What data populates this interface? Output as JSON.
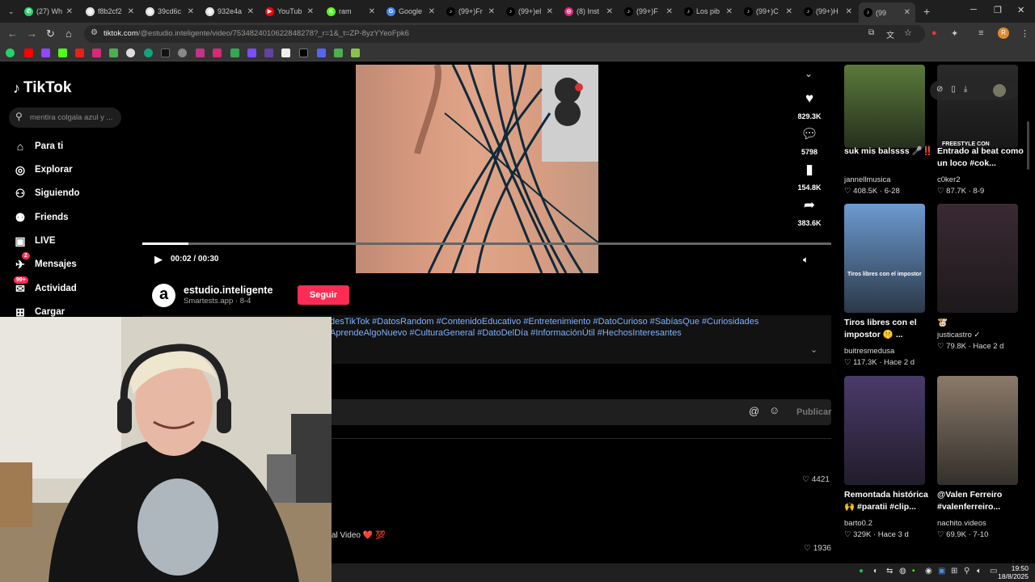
{
  "tabs": [
    {
      "label": "(27) Wh",
      "color": "#25d366",
      "glyph": "✆"
    },
    {
      "label": "f8b2cf2",
      "color": "#e0e0e0",
      "glyph": "◍"
    },
    {
      "label": "39cd6c",
      "color": "#e0e0e0",
      "glyph": "◍"
    },
    {
      "label": "932e4a",
      "color": "#e0e0e0",
      "glyph": "◍"
    },
    {
      "label": "YouTub",
      "color": "#ff0000",
      "glyph": "▶"
    },
    {
      "label": "ram",
      "color": "#53fc18",
      "glyph": "K"
    },
    {
      "label": "Google",
      "color": "#4285f4",
      "glyph": "G"
    },
    {
      "label": "(99+)Fr",
      "color": "#000",
      "glyph": "♪"
    },
    {
      "label": "(99+)el",
      "color": "#000",
      "glyph": "♪"
    },
    {
      "label": "(8) Inst",
      "color": "#d62976",
      "glyph": "◎"
    },
    {
      "label": "(99+)F",
      "color": "#000",
      "glyph": "♪"
    },
    {
      "label": "Los pib",
      "color": "#000",
      "glyph": "♪"
    },
    {
      "label": "(99+)C",
      "color": "#000",
      "glyph": "♪"
    },
    {
      "label": "(99+)H",
      "color": "#000",
      "glyph": "♪"
    },
    {
      "label": "(99",
      "color": "#000",
      "glyph": "♪"
    }
  ],
  "address": {
    "host": "tiktok.com",
    "path": "/@estudio.inteligente/video/7534824010622848278?_r=1&_t=ZP-8yzYYeoFpk6"
  },
  "sidebar": {
    "logo": "TikTok",
    "search_placeholder": "mentira colgala azul y ...",
    "items": [
      {
        "label": "Para ti",
        "icon": "home-icon"
      },
      {
        "label": "Explorar",
        "icon": "compass-icon"
      },
      {
        "label": "Siguiendo",
        "icon": "following-icon"
      },
      {
        "label": "Friends",
        "icon": "friends-icon"
      },
      {
        "label": "LIVE",
        "icon": "live-icon"
      },
      {
        "label": "Mensajes",
        "icon": "messages-icon",
        "badge": "2"
      },
      {
        "label": "Actividad",
        "icon": "activity-icon",
        "badge": "99+"
      },
      {
        "label": "Cargar",
        "icon": "upload-icon"
      }
    ]
  },
  "player": {
    "time": "00:02 / 00:30",
    "progress": 0.067
  },
  "actions": {
    "likes": "829.3K",
    "comments": "5798",
    "saves": "154.8K",
    "shares": "383.6K"
  },
  "author": {
    "name": "estudio.inteligente",
    "meta": "Smartests.app · 8-4",
    "follow": "Seguir",
    "avatar_letter": "a"
  },
  "description": {
    "line1": "desTikTok #DatosRandom #ContenidoEducativo #Entretenimiento #DatoCurioso #SabíasQue #Curiosidades",
    "line2": "AprendeAlgoNuevo #CulturaGeneral #DatoDelDía #InformaciónÚtil #HechosInteresantes"
  },
  "comments": {
    "publish": "Publicar",
    "like1": "4421",
    "like2": "1936",
    "snippet": "al Video ❤️ 💯"
  },
  "cards": [
    {
      "title": "suk mis balssss 🎤‼️",
      "user": "jannellmusica",
      "stats": "♡ 408.5K · 6-28",
      "color": "#5a7a3a"
    },
    {
      "title": "Entrado al beat como un loco #cok...",
      "user": "c0ker2",
      "stats": "♡ 87.7K · 8-9",
      "color": "#2a2a2a",
      "overlay": "FREESTYLE CON"
    },
    {
      "title": "Tiros libres con el impostor 🤫 ...",
      "user": "buitresmedusa",
      "stats": "♡ 117.3K · Hace 2 d",
      "color": "#6c9ad0",
      "overlay": "Tiros libres con el impostor"
    },
    {
      "title": "🐮",
      "user": "justicastro ✓",
      "stats": "♡ 79.8K · Hace 2 d",
      "color": "#3a2a33"
    },
    {
      "title": "Remontada histórica 🙌 #paratii #clip...",
      "user": "barto0.2",
      "stats": "♡ 329K · Hace 3 d",
      "color": "#4a3a6a"
    },
    {
      "title": "@Valen Ferreiro #valenferreiro...",
      "user": "nachito.videos",
      "stats": "♡ 69.9K · 7-10",
      "color": "#8a7a6a"
    }
  ],
  "taskbar": {
    "time": "19:50",
    "date": "18/8/2025"
  }
}
